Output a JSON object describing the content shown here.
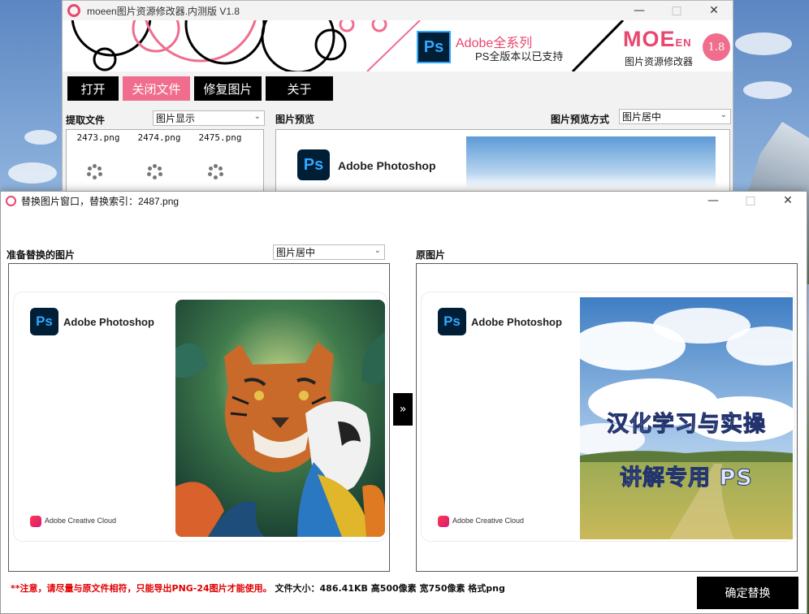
{
  "main_window": {
    "title": "moeen图片资源修改器.内测版 V1.8",
    "controls": {
      "minimize": "—",
      "maximize": "□",
      "close": "✕"
    },
    "banner": {
      "ps_badge": "Ps",
      "heading": "Adobe全系列",
      "subheading": "PS全版本以已支持",
      "brand": "MOE",
      "brand_suffix": "EN",
      "brand_sub": "图片资源修改器",
      "version": "1.8"
    },
    "toolbar": {
      "open": "打开",
      "close_file": "关闭文件",
      "repair": "修复图片",
      "about": "关于"
    },
    "extract_label": "提取文件",
    "display_select": "图片显示",
    "preview_label": "图片预览",
    "preview_mode_label": "图片预览方式",
    "preview_mode_select": "图片居中",
    "files": [
      "2473.png",
      "2474.png",
      "2475.png"
    ],
    "preview_card": {
      "ps_logo": "Ps",
      "product": "Adobe Photoshop"
    }
  },
  "dialog": {
    "title": "替换图片窗口，替换索引：2487.png",
    "controls": {
      "minimize": "—",
      "maximize": "□",
      "close": "✕"
    },
    "left_label": "准备替换的图片",
    "align_select": "图片居中",
    "right_label": "原图片",
    "left_card": {
      "ps_logo": "Ps",
      "product": "Adobe Photoshop",
      "cc": "Adobe Creative Cloud"
    },
    "right_card": {
      "ps_logo": "Ps",
      "product": "Adobe Photoshop",
      "cc": "Adobe Creative Cloud",
      "overlay_line1": "汉化学习与实操",
      "overlay_line2": "讲解专用 PS"
    },
    "arrow": "»",
    "note_warning": "**注意，请尽量与原文件相符，只能导出PNG-24图片才能使用。",
    "note_info": "文件大小：486.41KB 高500像素 宽750像素 格式png",
    "confirm_button": "确定替换"
  },
  "colors": {
    "accent_pink": "#f06d8e",
    "ps_navy": "#001e36",
    "ps_blue": "#31a8ff",
    "warning_red": "#e00000"
  }
}
